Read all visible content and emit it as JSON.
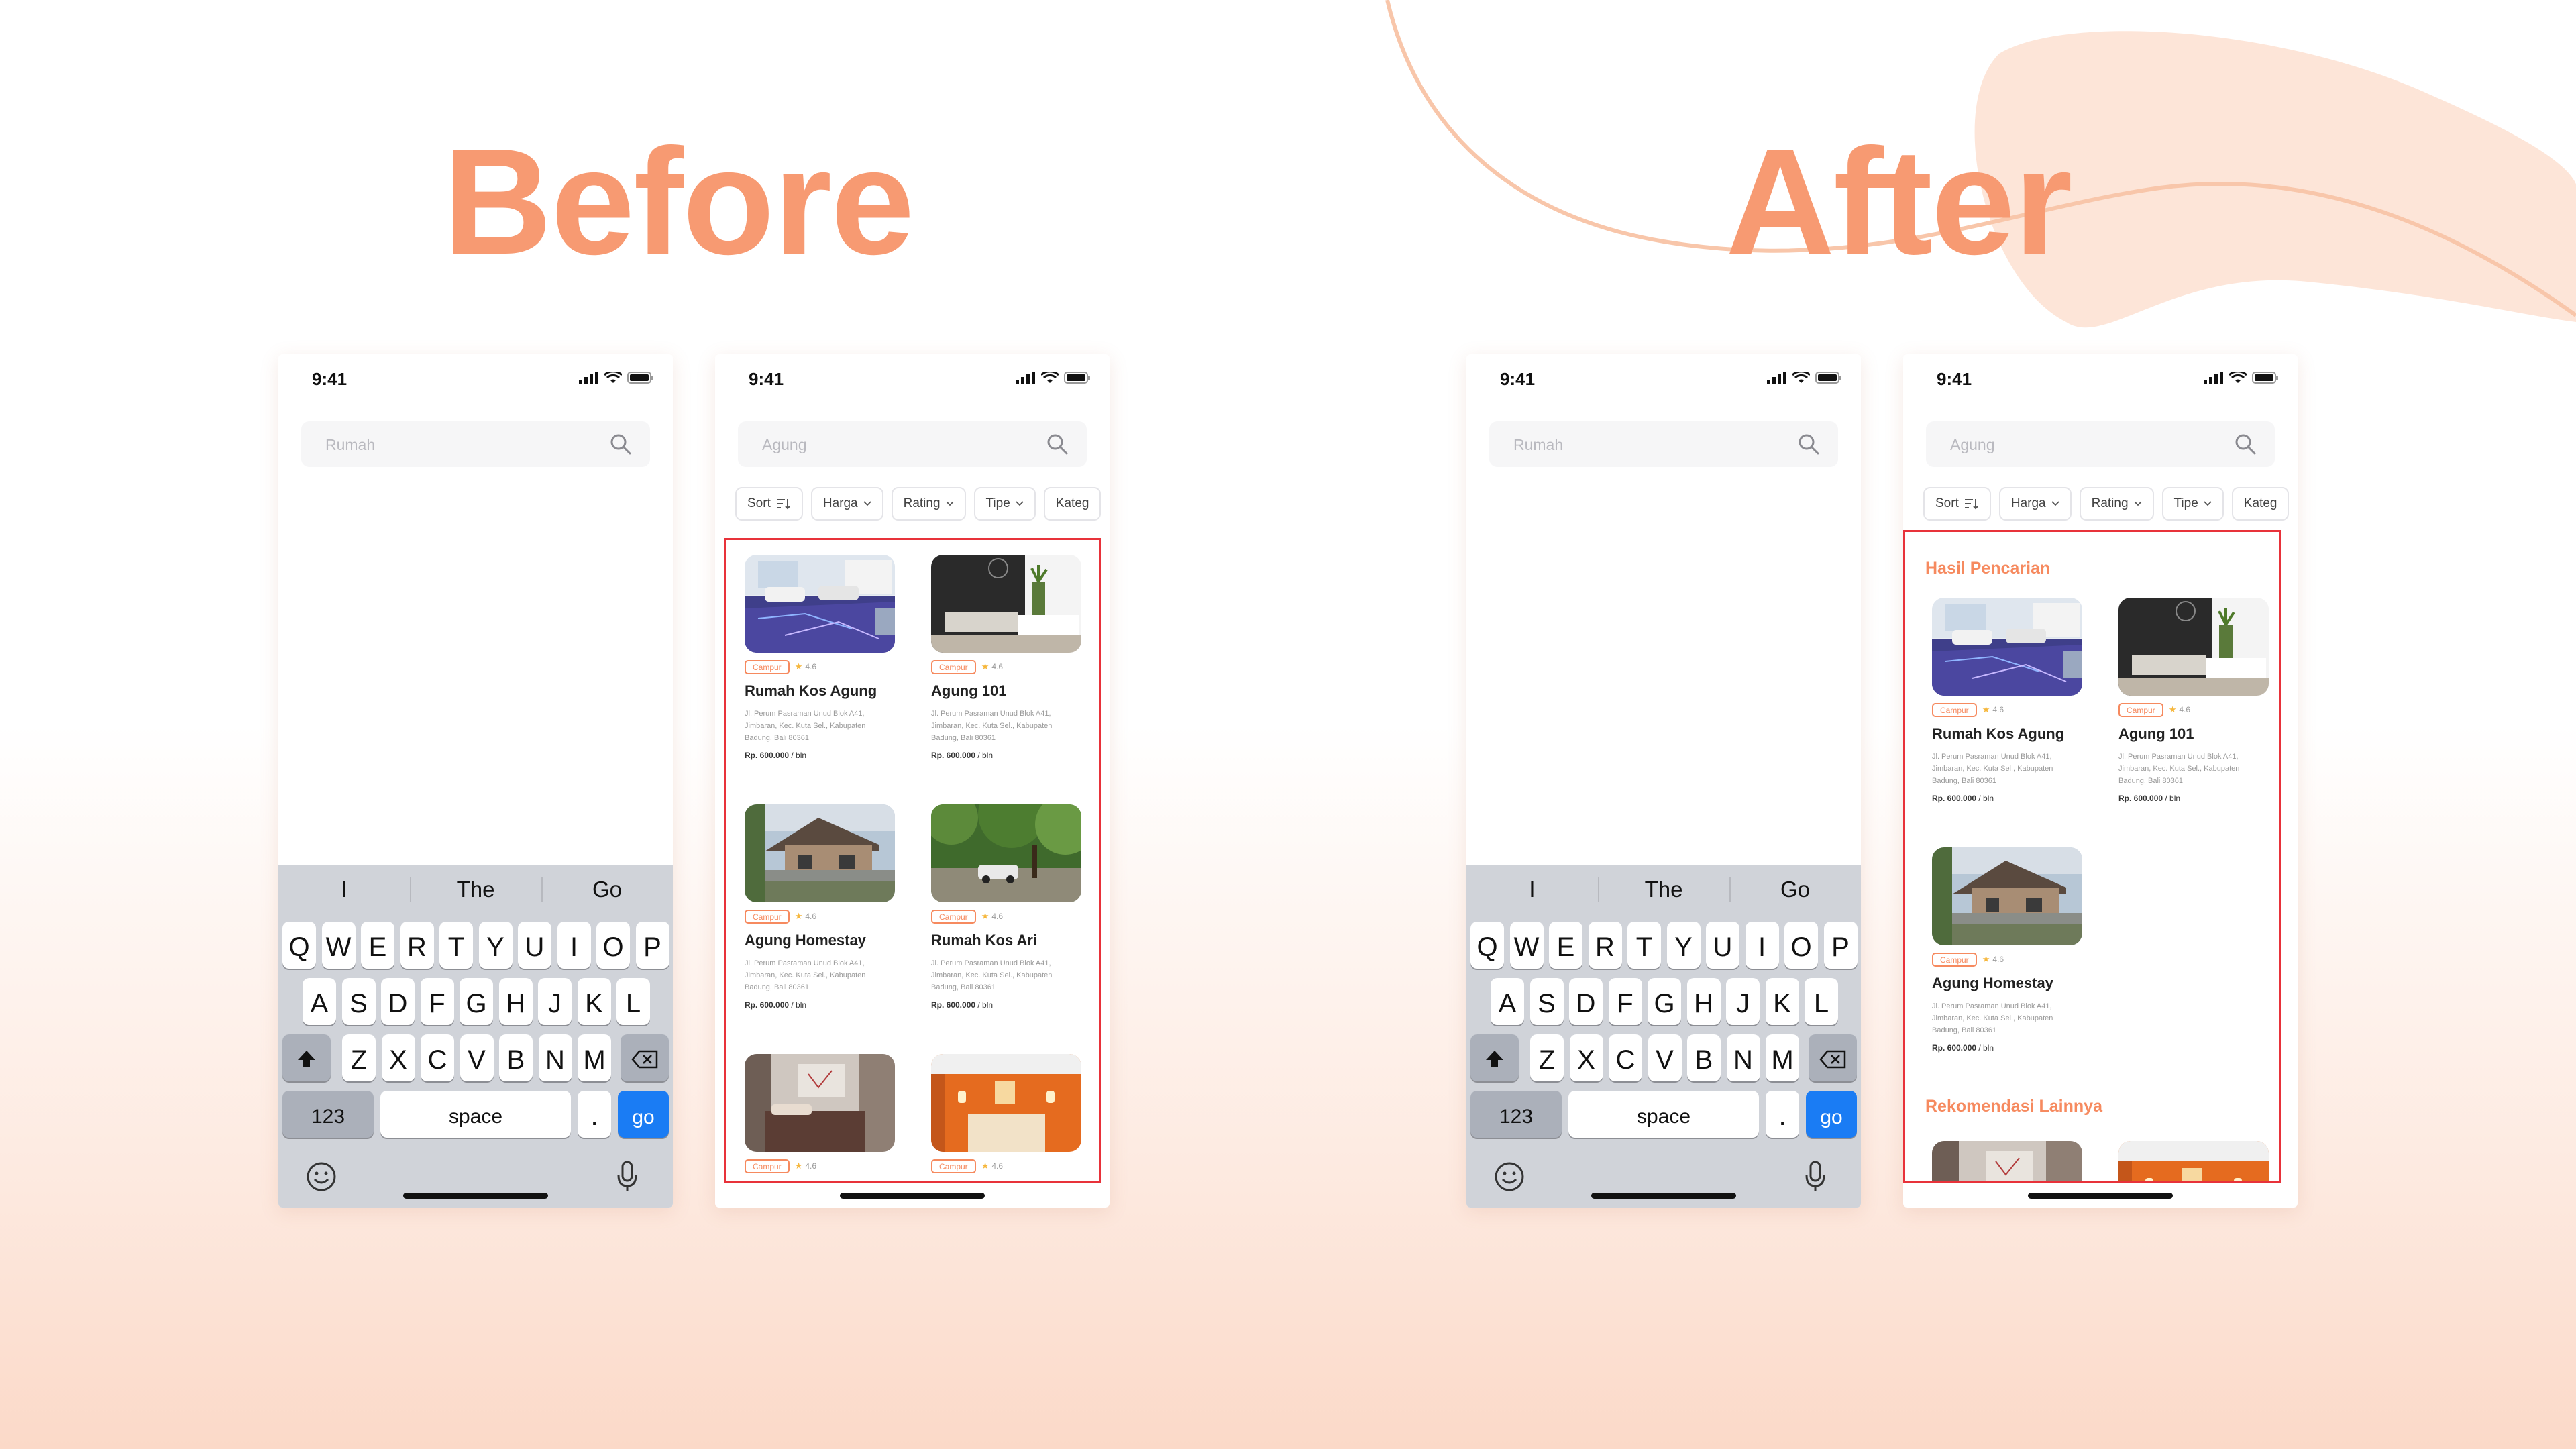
{
  "headings": {
    "before": "Before",
    "after": "After"
  },
  "colors": {
    "accent": "#f79a72",
    "highlight_border": "#e8323a",
    "go_key": "#1a7cf4"
  },
  "status": {
    "time": "9:41"
  },
  "phones": {
    "before_keyboard": {
      "search_placeholder": "Rumah"
    },
    "before_results": {
      "search_placeholder": "Agung"
    },
    "after_keyboard": {
      "search_placeholder": "Rumah"
    },
    "after_results": {
      "search_placeholder": "Agung",
      "section_title": "Hasil Pencarian",
      "section2_title": "Rekomendasi Lainnya"
    }
  },
  "filters": {
    "sort": "Sort",
    "harga": "Harga",
    "rating": "Rating",
    "tipe": "Tipe",
    "kategori": "Kateg"
  },
  "keyboard": {
    "suggestions": [
      "I",
      "The",
      "Go"
    ],
    "row1": [
      "Q",
      "W",
      "E",
      "R",
      "T",
      "Y",
      "U",
      "I",
      "O",
      "P"
    ],
    "row2": [
      "A",
      "S",
      "D",
      "F",
      "G",
      "H",
      "J",
      "K",
      "L"
    ],
    "row3": [
      "Z",
      "X",
      "C",
      "V",
      "B",
      "N",
      "M"
    ],
    "numbers": "123",
    "space": "space",
    "period": ".",
    "go": "go"
  },
  "listings": [
    {
      "tag": "Campur",
      "rating": "4.6",
      "title": "Rumah Kos Agung",
      "address": "Jl. Perum Pasraman Unud Blok A41, Jimbaran, Kec. Kuta Sel., Kabupaten Badung, Bali 80361",
      "price": "Rp. 600.000",
      "unit": "/ bln"
    },
    {
      "tag": "Campur",
      "rating": "4.6",
      "title": "Agung 101",
      "address": "Jl. Perum Pasraman Unud Blok A41, Jimbaran, Kec. Kuta Sel., Kabupaten Badung, Bali 80361",
      "price": "Rp. 600.000",
      "unit": "/ bln"
    },
    {
      "tag": "Campur",
      "rating": "4.6",
      "title": "Agung Homestay",
      "address": "Jl. Perum Pasraman Unud Blok A41, Jimbaran, Kec. Kuta Sel., Kabupaten Badung, Bali 80361",
      "price": "Rp. 600.000",
      "unit": "/ bln"
    },
    {
      "tag": "Campur",
      "rating": "4.6",
      "title": "Rumah Kos Ari",
      "address": "Jl. Perum Pasraman Unud Blok A41, Jimbaran, Kec. Kuta Sel., Kabupaten Badung, Bali 80361",
      "price": "Rp. 600.000",
      "unit": "/ bln"
    },
    {
      "tag": "Campur",
      "rating": "4.6"
    },
    {
      "tag": "Campur",
      "rating": "4.6"
    }
  ]
}
